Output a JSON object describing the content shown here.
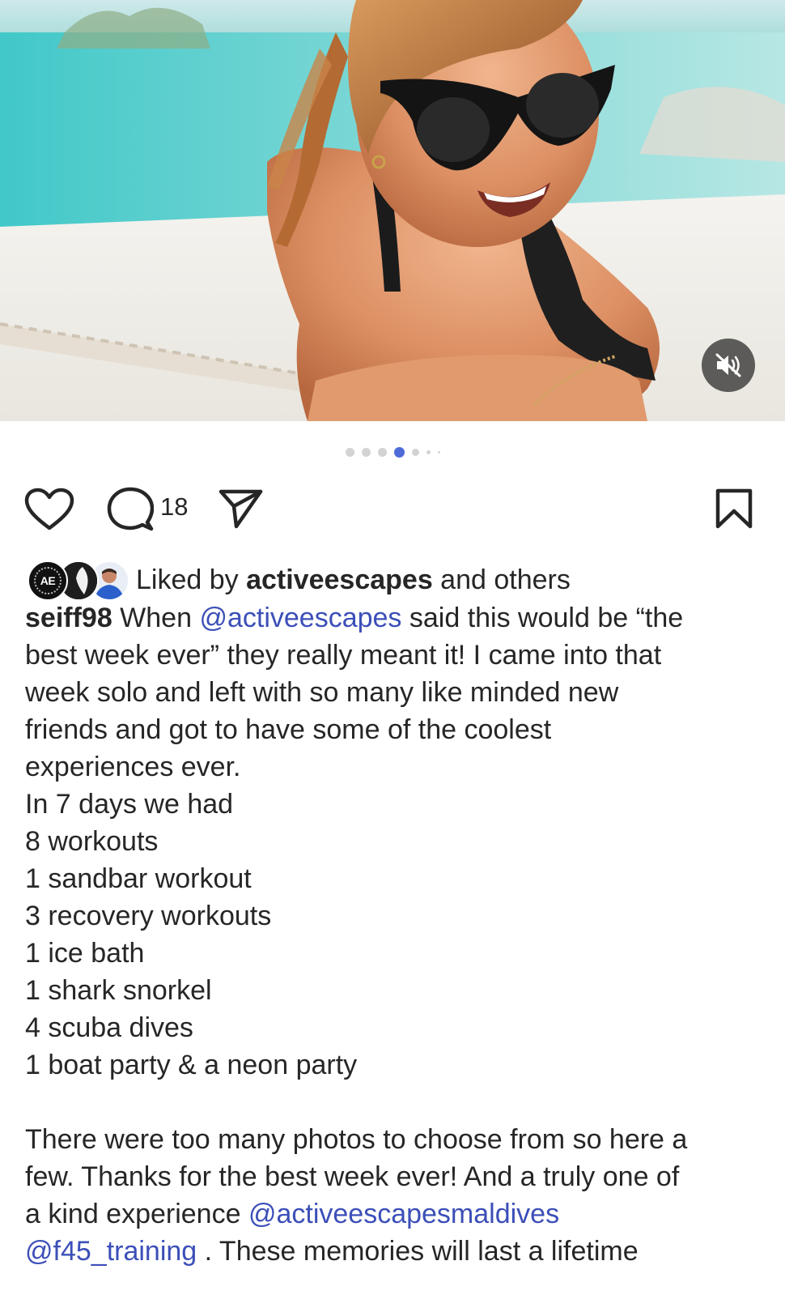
{
  "media": {
    "image_icon": "photo-of-woman-in-sunglasses-at-beach",
    "mute_icon": "speaker-muted-icon"
  },
  "carousel": {
    "count": 7,
    "active_index": 3,
    "active_color": "#4f6bd8"
  },
  "actions": {
    "like_icon": "heart-icon",
    "comment_icon": "comment-bubble-icon",
    "comment_count": "18",
    "share_icon": "send-icon",
    "save_icon": "bookmark-icon"
  },
  "liked_by": {
    "prefix": "Liked by ",
    "user": "activeescapes",
    "suffix": " and others",
    "avatar_initials": "AE"
  },
  "caption": {
    "username": "seiff98",
    "mention_color": "#3c4fb8",
    "lines": {
      "l1_text": " When ",
      "l1_mention": "@activeescapes",
      "l1_tail": " said this would be “the",
      "l2": "best week ever” they really meant it! I came into that",
      "l3": "week solo and left with so many like minded new",
      "l4": "friends and got to have some of the coolest",
      "l5": "experiences ever.",
      "l6": "In 7 days we had",
      "l7": "8 workouts",
      "l8": "1 sandbar workout",
      "l9": "3 recovery workouts",
      "l10": "1 ice bath",
      "l11": "1 shark snorkel",
      "l12": "4 scuba dives",
      "l13": "1 boat party & a neon party",
      "l14": "There were too many photos to choose from so here a",
      "l15": "few. Thanks for the best week ever! And a truly one of",
      "l16_text": "a kind experience ",
      "l16_mention": "@activeescapesmaldives",
      "l17_mention": "@f45_training",
      "l17_tail": " . These memories will last a lifetime"
    }
  }
}
